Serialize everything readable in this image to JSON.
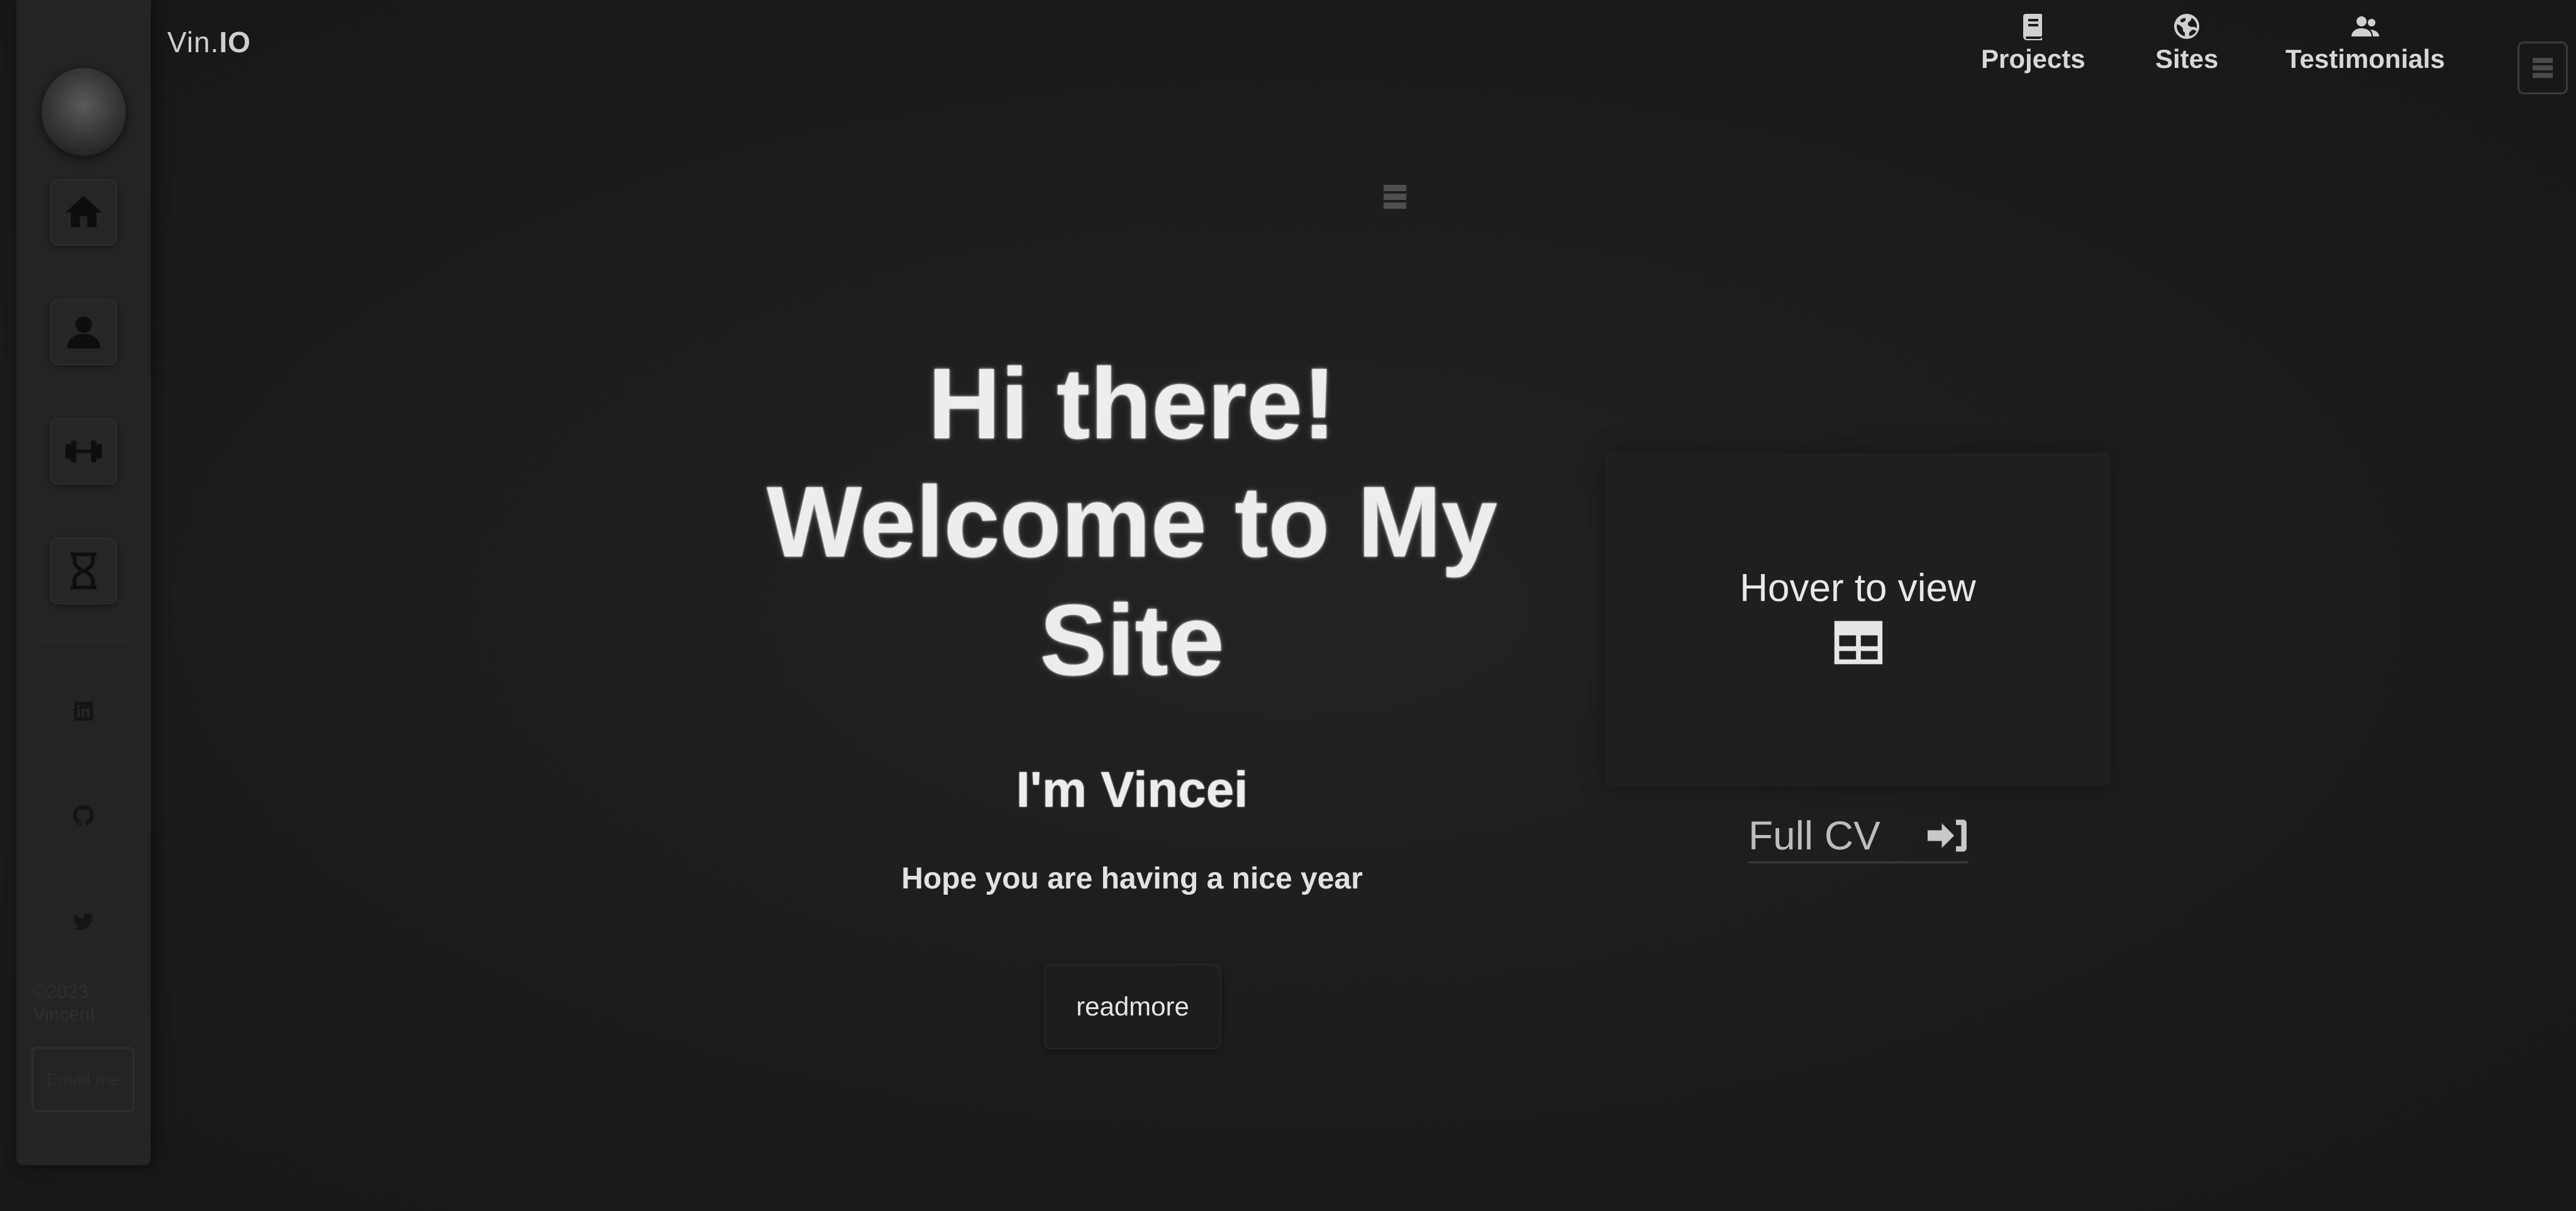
{
  "brand": {
    "prefix": "Vin.",
    "suffix": "IO"
  },
  "nav": {
    "items": [
      {
        "label": "Projects",
        "icon": "book-icon"
      },
      {
        "label": "Sites",
        "icon": "globe-icon"
      },
      {
        "label": "Testimonials",
        "icon": "users-icon"
      }
    ]
  },
  "sidebar": {
    "buttons": [
      {
        "name": "home-icon"
      },
      {
        "name": "user-icon"
      },
      {
        "name": "dumbbell-icon"
      },
      {
        "name": "hourglass-icon"
      }
    ],
    "socials": [
      {
        "name": "linkedin-icon"
      },
      {
        "name": "github-icon"
      },
      {
        "name": "twitter-icon"
      }
    ],
    "copyright": "©2023 Vincent",
    "contact_label": "Email me"
  },
  "hero": {
    "title": "Hi there! Welcome to My Site",
    "name": "I'm Vincei",
    "subtitle": "Hope you are having a nice year",
    "readmore_label": "readmore"
  },
  "preview": {
    "label": "Hover to view",
    "icon": "table-icon",
    "cv_label": "Full CV",
    "cv_icon": "sign-in-icon"
  }
}
